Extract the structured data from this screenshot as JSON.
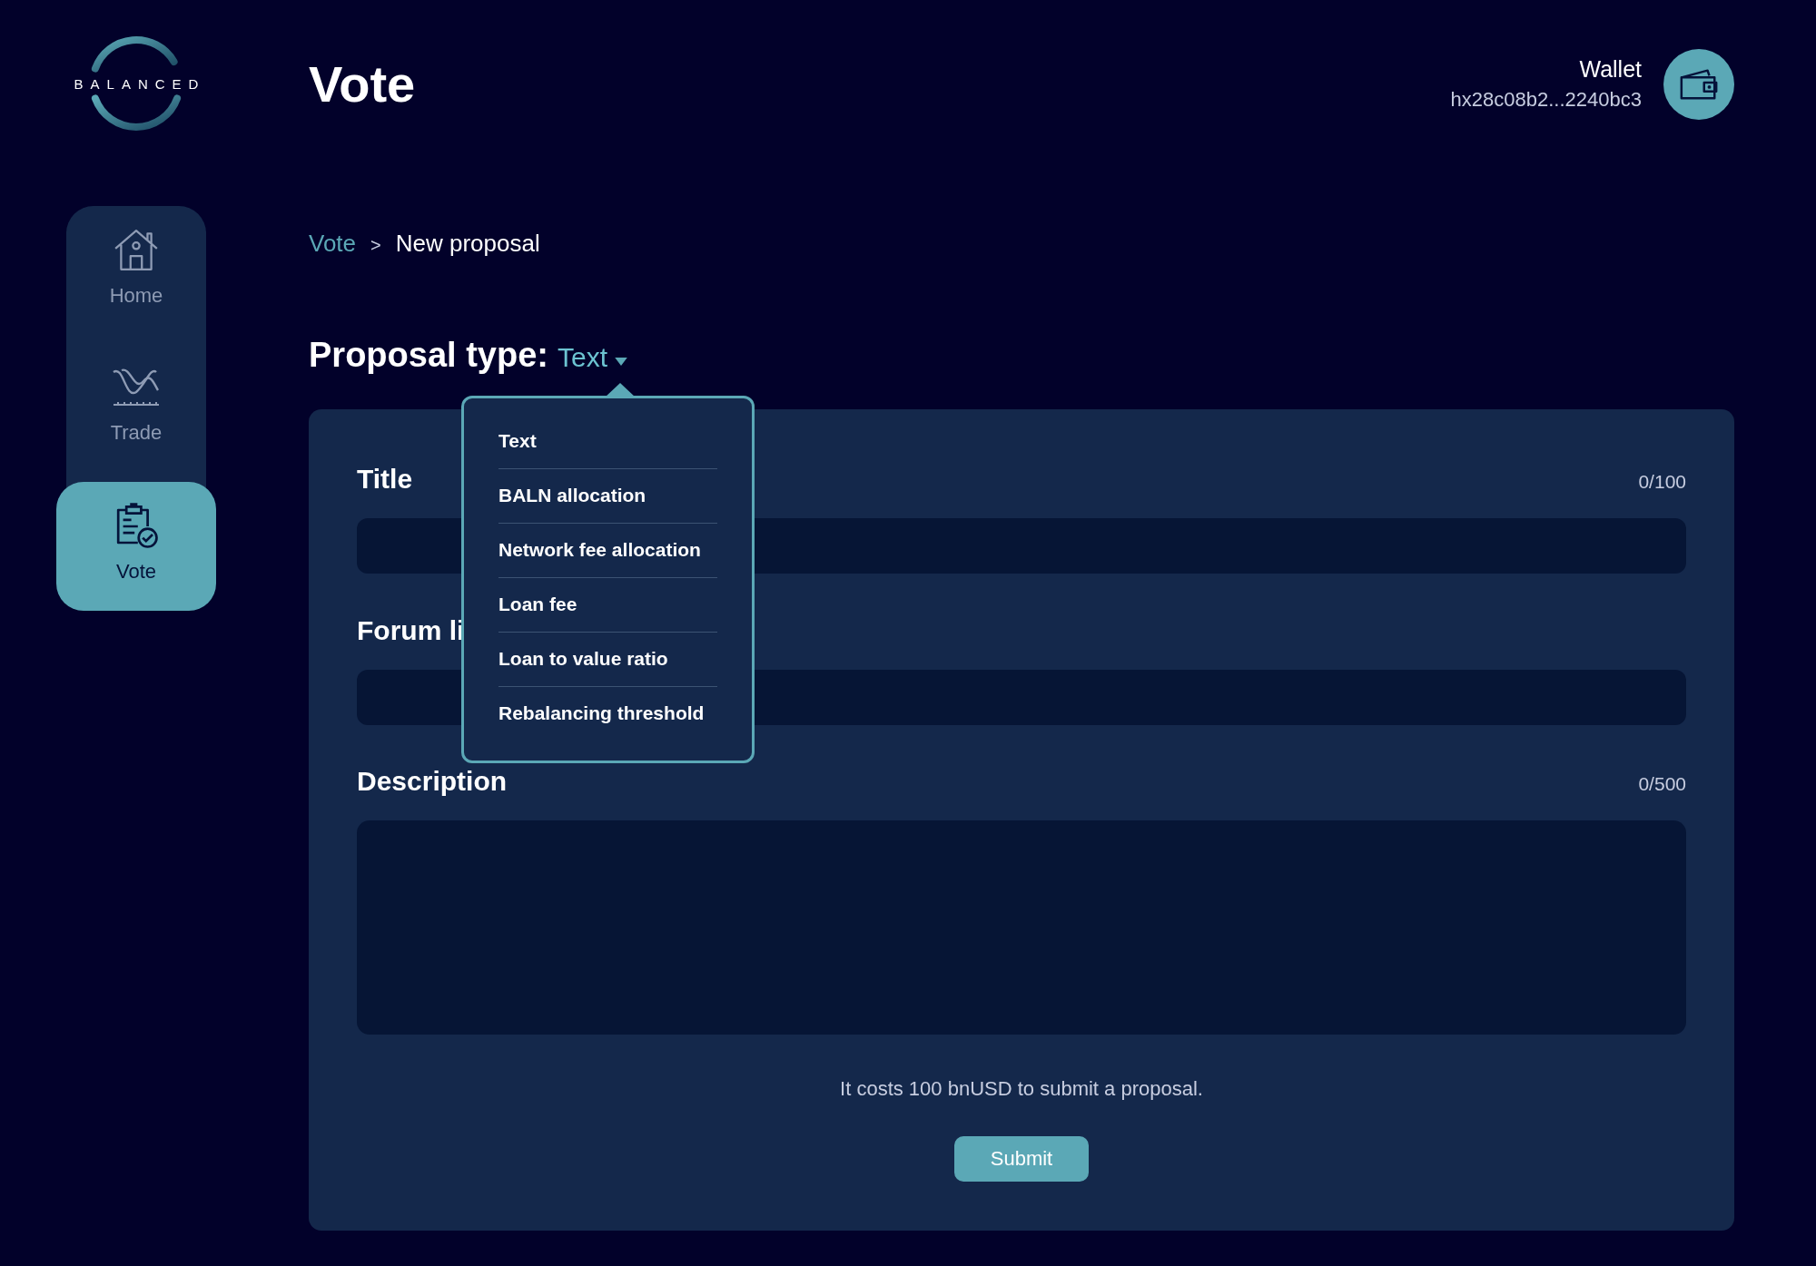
{
  "logo": {
    "text": "BALANCED"
  },
  "page_title": "Vote",
  "wallet": {
    "label": "Wallet",
    "address": "hx28c08b2...2240bc3"
  },
  "sidebar": {
    "items": [
      {
        "label": "Home",
        "kind": "home",
        "selected": false
      },
      {
        "label": "Trade",
        "kind": "trade",
        "selected": false
      },
      {
        "label": "Vote",
        "kind": "vote",
        "selected": true
      }
    ]
  },
  "breadcrumb": {
    "parent": "Vote",
    "separator": ">",
    "current": "New proposal"
  },
  "proposal_type": {
    "label": "Proposal type:",
    "value": "Text",
    "open": true,
    "options": [
      "Text",
      "BALN allocation",
      "Network fee allocation",
      "Loan fee",
      "Loan to value ratio",
      "Rebalancing threshold"
    ]
  },
  "form": {
    "fields": [
      {
        "label": "Title",
        "counter": "0/100",
        "kind": "input"
      },
      {
        "label": "Forum li",
        "kind": "input"
      },
      {
        "label": "Description",
        "counter": "0/500",
        "kind": "textarea"
      }
    ],
    "note": "It costs 100 bnUSD to submit a proposal.",
    "submit": "Submit"
  }
}
